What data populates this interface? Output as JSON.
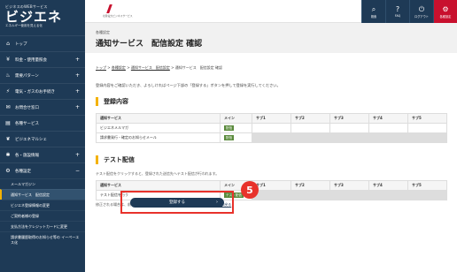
{
  "sidebar": {
    "logo_sup": "ビジネスのWEBサービス",
    "logo_main": "ビジエネ",
    "logo_sub": "エネルギー使用を見える化",
    "items": [
      {
        "icon": "home-icon",
        "glyph": "⌂",
        "label": "トップ",
        "plus": ""
      },
      {
        "icon": "yen-icon",
        "glyph": "¥",
        "label": "料金・使用量照会",
        "plus": "+"
      },
      {
        "icon": "flame-icon",
        "glyph": "♨",
        "label": "需要パターン",
        "plus": "+"
      },
      {
        "icon": "plug-icon",
        "glyph": "⚡",
        "label": "電気・ガスのお手続き",
        "plus": "+"
      },
      {
        "icon": "contact-icon",
        "glyph": "✉",
        "label": "お問合せ窓口",
        "plus": "+"
      },
      {
        "icon": "document-icon",
        "glyph": "▤",
        "label": "各種サービス",
        "plus": ""
      },
      {
        "icon": "leaf-icon",
        "glyph": "❦",
        "label": "ビジエネマルシェ",
        "plus": ""
      },
      {
        "icon": "settings-icon",
        "glyph": "✱",
        "label": "各・施設情報",
        "plus": "+"
      },
      {
        "icon": "gear-icon",
        "glyph": "⚙",
        "label": "各種設定",
        "plus": "−"
      }
    ],
    "sub_items": [
      {
        "label": "メールマガジン",
        "active": false
      },
      {
        "label": "通知サービス　配信設定",
        "active": true
      },
      {
        "label": "ビジエネ登録情報の変更",
        "active": false
      },
      {
        "label": "ご契約者様の登録",
        "active": false
      },
      {
        "label": "支払方法をクレジットカードに変更",
        "active": false
      },
      {
        "label": "請求書履歴取得のお知らせ等の イーペーエス化",
        "active": false
      }
    ]
  },
  "header": {
    "brand_text": "北陸電力ビジネスサービス",
    "buttons": [
      {
        "icon": "search-icon",
        "glyph": "⌕",
        "label": "検索"
      },
      {
        "icon": "help-icon",
        "glyph": "?",
        "label": "FAQ"
      },
      {
        "icon": "logout-icon",
        "glyph": "⏻",
        "label": "ログアウト"
      },
      {
        "icon": "settings-icon",
        "glyph": "⚙",
        "label": "各種設定"
      }
    ]
  },
  "page": {
    "category": "各種設定",
    "title": "通知サービス　配信設定 確認"
  },
  "breadcrumb": {
    "top": "トップ",
    "sep": ">",
    "settings": "各種設定",
    "notify": "通知サービス　配信設定",
    "current": "通知サービス　配信設定 確認"
  },
  "intro": "登録内容をご確認いただき、よろしければページ下部の「登録する」ボタンを押して登録を実行してください。",
  "registration": {
    "title": "登録内容",
    "headers": [
      "通知サービス",
      "メイン",
      "サブ1",
      "サブ2",
      "サブ3",
      "サブ4",
      "サブ5"
    ],
    "rows": [
      {
        "name": "ビジエネメルマガ",
        "main": "配信"
      },
      {
        "name": "請求書発行・確定のお知らせメール",
        "main": "配信"
      }
    ]
  },
  "test": {
    "title": "テスト配信",
    "note": "テスト配信をクリックすると、登録された送信先へテスト配信が行われます。",
    "headers": [
      "通知サービス",
      "メイン",
      "サブ1",
      "サブ2",
      "サブ3",
      "サブ4",
      "サブ5"
    ],
    "rows": [
      {
        "name": "テスト配信を行う",
        "main": "テスト配信"
      }
    ]
  },
  "bottom_note": {
    "text": "修正される場合は、前のページに戻り変更ください。",
    "link": "通知サービス　配信設定へ戻る"
  },
  "submit": {
    "label": "登録する",
    "arrow": "›"
  },
  "step_badge": "5"
}
